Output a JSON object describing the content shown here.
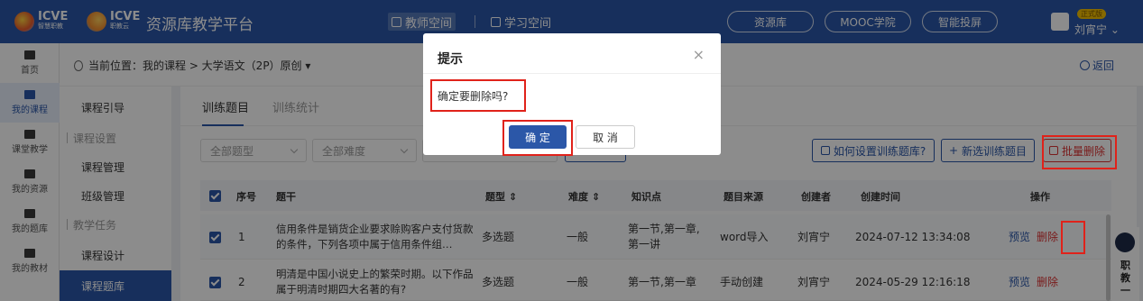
{
  "header": {
    "logo1_text": "ICVE",
    "logo1_sub": "智慧职教",
    "logo2_text": "ICVE",
    "logo2_sub": "职教云",
    "platform_title": "资源库教学平台",
    "tabs": [
      {
        "label": "教师空间",
        "active": true
      },
      {
        "label": "学习空间",
        "active": false
      }
    ],
    "pills": [
      "资源库",
      "MOOC学院",
      "智能投屏"
    ],
    "user_badge": "正式版",
    "user_name": "刘宵宁"
  },
  "left_nav": [
    {
      "label": "首页",
      "icon": "home-icon"
    },
    {
      "label": "我的课程",
      "icon": "book-icon",
      "active": true
    },
    {
      "label": "课堂教学",
      "icon": "play-icon"
    },
    {
      "label": "我的资源",
      "icon": "resource-icon"
    },
    {
      "label": "我的题库",
      "icon": "question-bank-icon"
    },
    {
      "label": "我的教材",
      "icon": "textbook-icon"
    }
  ],
  "breadcrumb": {
    "text": "当前位置：我的课程 > 大学语文（2P）原创 ▾",
    "back_label": "返回"
  },
  "sub_nav": [
    {
      "label": "课程引导",
      "type": "item"
    },
    {
      "label": "课程设置",
      "type": "group"
    },
    {
      "label": "课程管理",
      "type": "item"
    },
    {
      "label": "班级管理",
      "type": "item"
    },
    {
      "label": "教学任务",
      "type": "group"
    },
    {
      "label": "课程设计",
      "type": "item"
    },
    {
      "label": "课程题库",
      "type": "item",
      "active": true
    }
  ],
  "main": {
    "tabs": [
      "训练题目",
      "训练统计"
    ],
    "filters": [
      "全部题型",
      "全部难度"
    ],
    "how_to_label": "如何设置训练题库?",
    "add_label": "新选训练题目",
    "batch_delete_label": "批量删除",
    "columns": [
      "序号",
      "题干",
      "题型 ⇕",
      "难度 ⇕",
      "知识点",
      "题目来源",
      "创建者",
      "创建时间",
      "操作"
    ],
    "rows": [
      {
        "index": "1",
        "stem": "信用条件是销货企业要求赊购客户支付货款的条件，下列各项中属于信用条件组…",
        "type": "多选题",
        "difficulty": "一般",
        "knowledge": "第一节,第一章,第一讲",
        "source": "word导入",
        "creator": "刘宵宁",
        "created": "2024-07-12 13:34:08",
        "preview": "预览",
        "delete": "删除"
      },
      {
        "index": "2",
        "stem": "明清是中国小说史上的繁荣时期。以下作品属于明清时期四大名著的有?",
        "type": "多选题",
        "difficulty": "一般",
        "knowledge": "第一节,第一章",
        "source": "手动创建",
        "creator": "刘宵宁",
        "created": "2024-05-29 12:16:18",
        "preview": "预览",
        "delete": "删除"
      }
    ]
  },
  "assistant": {
    "label": "职教一"
  },
  "dialog": {
    "title": "提示",
    "message": "确定要删除吗?",
    "ok_label": "确 定",
    "cancel_label": "取 消"
  },
  "colors": {
    "brand": "#2b57a8",
    "danger": "#d33",
    "highlight": "#e0221a"
  }
}
